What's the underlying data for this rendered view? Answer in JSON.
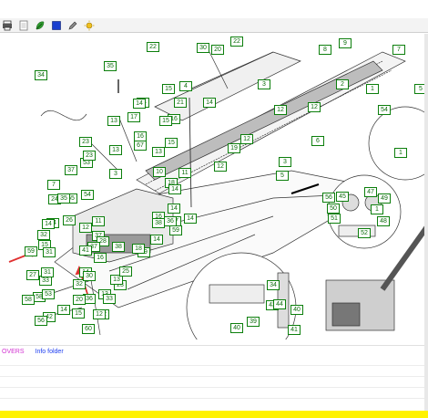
{
  "toolbar": {
    "buttons": [
      {
        "name": "print-icon",
        "color": "#333333"
      },
      {
        "name": "page-icon",
        "color": "#777777"
      },
      {
        "name": "leaf-icon",
        "color": "#1e7a1e"
      },
      {
        "name": "square-icon",
        "color": "#1a3fcf"
      },
      {
        "name": "pen-icon",
        "color": "#444444"
      },
      {
        "name": "sun-icon",
        "color": "#c8a000"
      }
    ]
  },
  "diagram": {
    "callouts": [
      "36",
      "30",
      "20",
      "22",
      "8",
      "9",
      "7",
      "35",
      "34",
      "2",
      "1",
      "5",
      "15",
      "14",
      "21",
      "4",
      "13",
      "14",
      "16",
      "3",
      "14",
      "12",
      "17",
      "11",
      "15",
      "16",
      "15",
      "12",
      "18",
      "12",
      "6",
      "13",
      "19",
      "13",
      "54",
      "53",
      "67",
      "10",
      "12",
      "1",
      "23",
      "5",
      "3",
      "54",
      "55",
      "37",
      "3",
      "7",
      "24",
      "14",
      "14",
      "16",
      "35",
      "14",
      "17",
      "11",
      "36",
      "14",
      "23",
      "26",
      "14",
      "12",
      "29",
      "37",
      "28",
      "32",
      "14",
      "59",
      "15",
      "49",
      "31",
      "37",
      "47",
      "56",
      "1",
      "51",
      "45",
      "52",
      "33",
      "32",
      "14",
      "48",
      "43",
      "57",
      "50",
      "58",
      "40",
      "58",
      "34",
      "44",
      "36",
      "39",
      "41",
      "40",
      "42",
      "56",
      "60",
      "59",
      "31",
      "16",
      "30",
      "23",
      "22",
      "13",
      "15",
      "13",
      "33",
      "14",
      "27",
      "41",
      "38",
      "18",
      "38",
      "53",
      "12",
      "25",
      "20",
      "22"
    ]
  },
  "footer": {
    "link1": "OVERS",
    "link2": "Info folder"
  },
  "colors": {
    "callout_border": "#0c7f0c",
    "callout_text": "#0c6d0c",
    "link_pink": "#d233d2",
    "link_blue": "#1e3ef0",
    "bottom_bar": "#fff200",
    "arrow_red": "#e03030"
  }
}
